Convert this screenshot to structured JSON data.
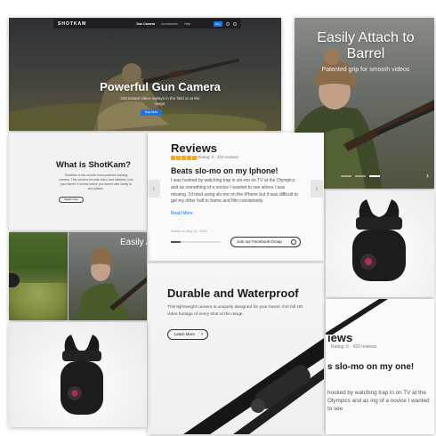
{
  "colors": {
    "accent": "#1a73e8",
    "star": "#f5a623",
    "dark": "#1b1b1b"
  },
  "hero": {
    "nav": {
      "logo": "SHOTKAM",
      "links": [
        "Gun Camera",
        "Accessories",
        "Help"
      ],
      "buy_label": "Buy"
    },
    "title": "Powerful Gun Camera",
    "subtitle": "Get instant video replays in the field or at the range.",
    "button": "Buy Now"
  },
  "attach": {
    "title": "Easily Attach to Barrel",
    "subtitle": "Patented grip for smooth videos",
    "next_icon": "chevron-right-icon"
  },
  "what_is": {
    "title": "What is ShotKam?",
    "body": "ShotKam is the world's most powerful training camera. This camera records video and attaches onto your barrel. It shows where you aimed with clarity to see pattern.",
    "button": "Watch Now"
  },
  "reviews": {
    "title": "Reviews",
    "stars": 5,
    "rating": "Rating: 5 · 423 reviews",
    "headline": "Beats slo-mo on my Iphone!",
    "body": "I was hooked by watching trap in slo-mo on TV at the Olympics and as something of a novice I wanted to see where I was missing. I'd tried using slo-mo on the iPhone but it was difficult to get my other half to frame and film consistently.",
    "read_more": "Read More",
    "date": "David on May 31, 2021",
    "facebook_button": "Join our Facebook Group",
    "progress_fraction": 0.2
  },
  "easy2": {
    "title": "Easily At to B"
  },
  "durable": {
    "title": "Durable and Waterproof",
    "body": "This lightweight camera is uniquely designed for your barrel. Get full HD video footage of every shot at the range.",
    "button": "Learn More"
  },
  "reviews2": {
    "title": "iews",
    "rating": "Rating: 5 · 423 reviews",
    "headline": "s slo-mo on my one!",
    "body": "hooked by watching trap in on TV at the Olympics and as ing of a novice I wanted to see"
  }
}
